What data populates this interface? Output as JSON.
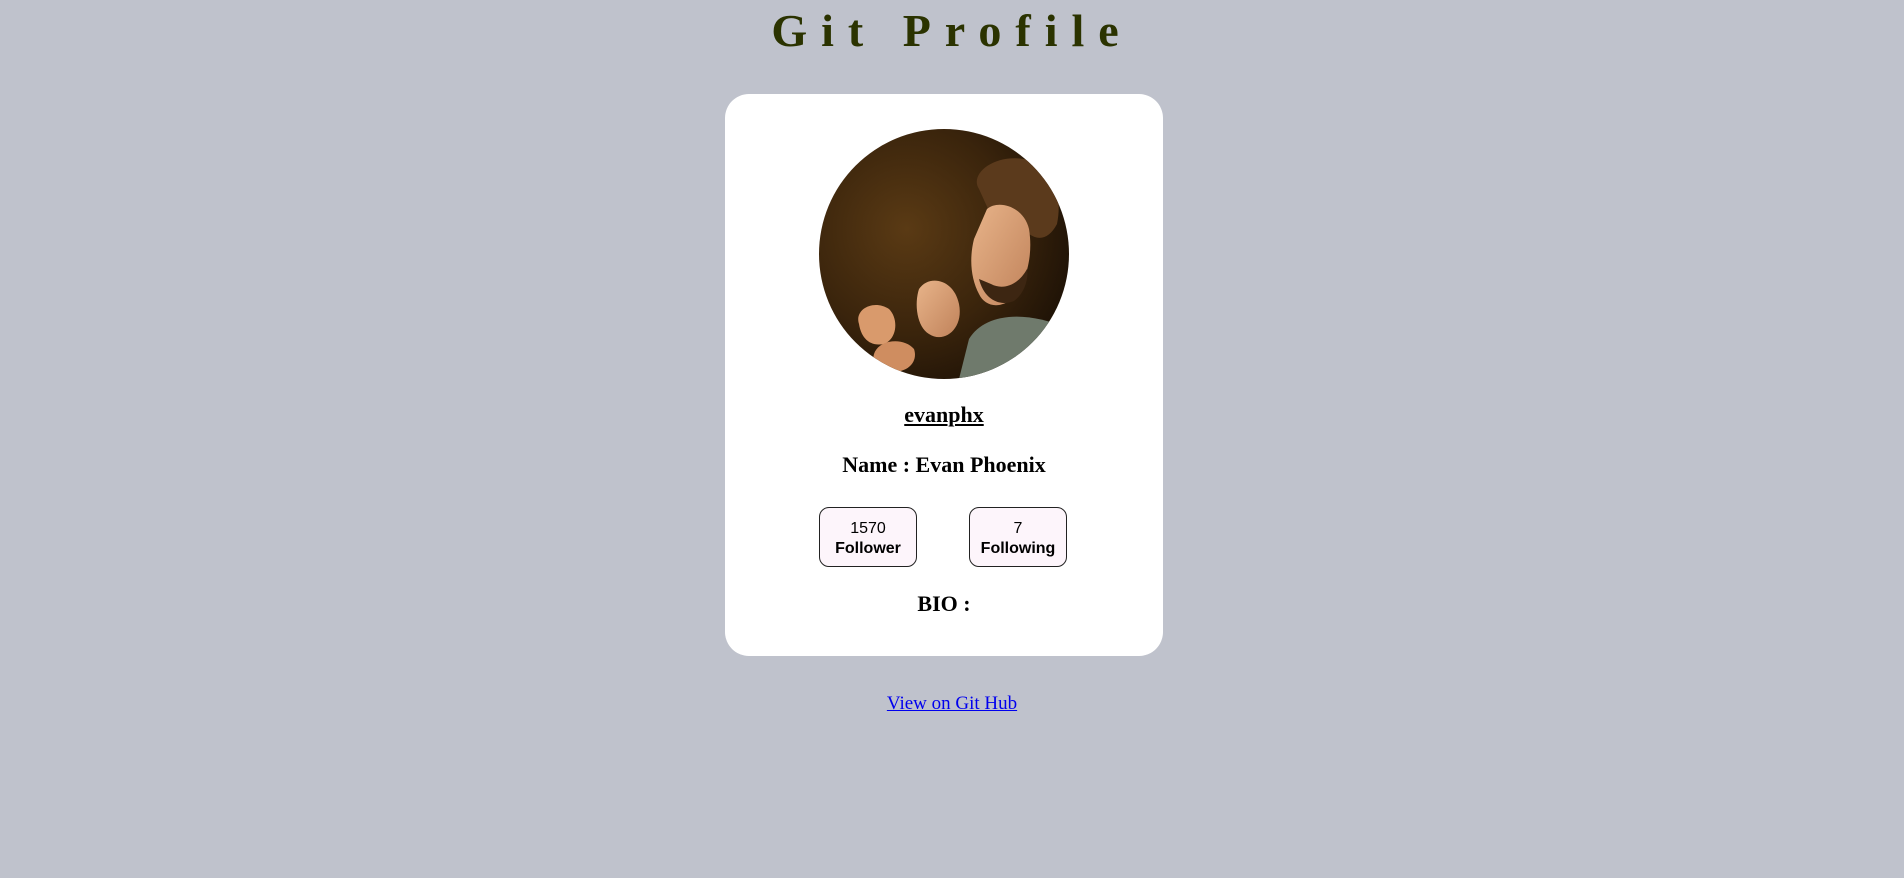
{
  "page": {
    "title": "Git Profile"
  },
  "profile": {
    "avatar": "profile-photo",
    "username": "evanphx",
    "name_line": "Name : Evan Phoenix",
    "followers": {
      "count": "1570",
      "label": "Follower"
    },
    "following": {
      "count": "7",
      "label": "Following"
    },
    "bio_label": "BIO :"
  },
  "link": {
    "label": "View on Git Hub"
  },
  "colors": {
    "background": "#bfc2cc",
    "title": "#2b3300",
    "card": "#ffffff",
    "stat_box": "#fdf5fb",
    "link": "#0000ee"
  }
}
